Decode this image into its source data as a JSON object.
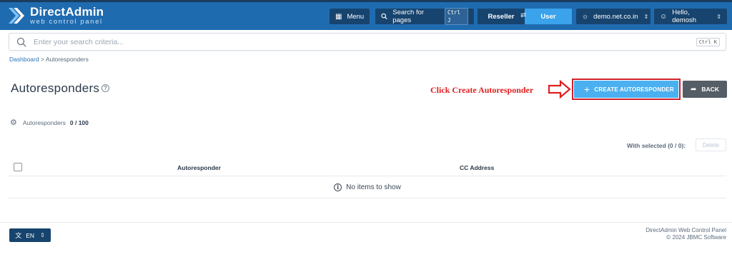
{
  "topbar": {
    "logo_title": "DirectAdmin",
    "logo_subtitle": "web control panel",
    "menu_label": "Menu",
    "search_label": "Search for pages",
    "search_shortcut": "Ctrl J",
    "role_reseller": "Reseller",
    "role_user": "User",
    "domain": "demo.net.co.in",
    "greeting": "Hello, demosh"
  },
  "search": {
    "placeholder": "Enter your search criteria...",
    "shortcut": "Ctrl K"
  },
  "breadcrumb": {
    "items": [
      "Dashboard",
      "Autoresponders"
    ],
    "separator": ">"
  },
  "page": {
    "title": "Autoresponders",
    "annotation": "Click Create Autoresponder",
    "create_label": "CREATE AUTORESPONDER",
    "back_label": "BACK"
  },
  "quota": {
    "label": "Autoresponders",
    "value": "0 / 100"
  },
  "table": {
    "with_selected": "With selected (0 / 0):",
    "delete_label": "Delete",
    "columns": [
      "Autoresponder",
      "CC Address"
    ],
    "empty_text": "No items to show"
  },
  "footer": {
    "language": "EN",
    "product": "DirectAdmin Web Control Panel",
    "copyright": "© 2024 JBMC Software"
  },
  "colors": {
    "topbar": "#1f6bb0",
    "accent": "#4ab0f0",
    "annotation": "#e02020"
  }
}
